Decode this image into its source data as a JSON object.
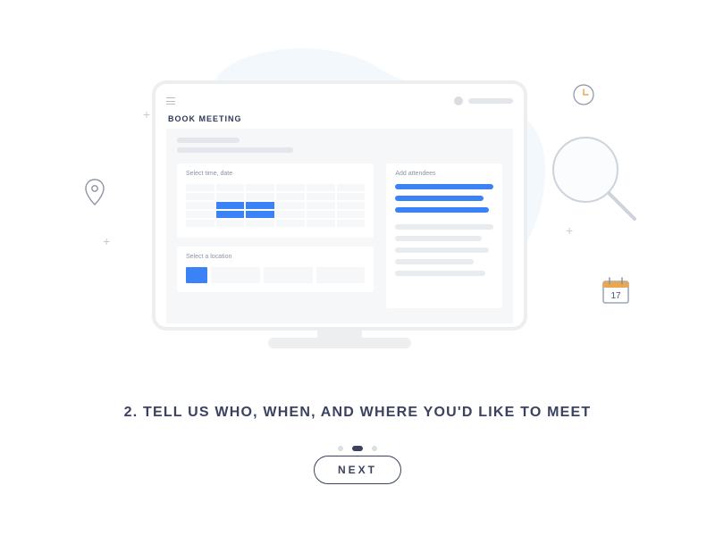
{
  "screen": {
    "title": "BOOK MEETING",
    "panels": {
      "time_date_label": "Select time, date",
      "attendees_label": "Add attendees",
      "location_label": "Select a location"
    }
  },
  "calendar_icon_date": "17",
  "step": {
    "heading": "2. TELL US WHO, WHEN, AND WHERE YOU'D LIKE TO MEET"
  },
  "pager": {
    "count": 3,
    "active_index": 1
  },
  "next_button_label": "NEXT",
  "colors": {
    "accent": "#3b82f6",
    "text": "#3a4260"
  }
}
